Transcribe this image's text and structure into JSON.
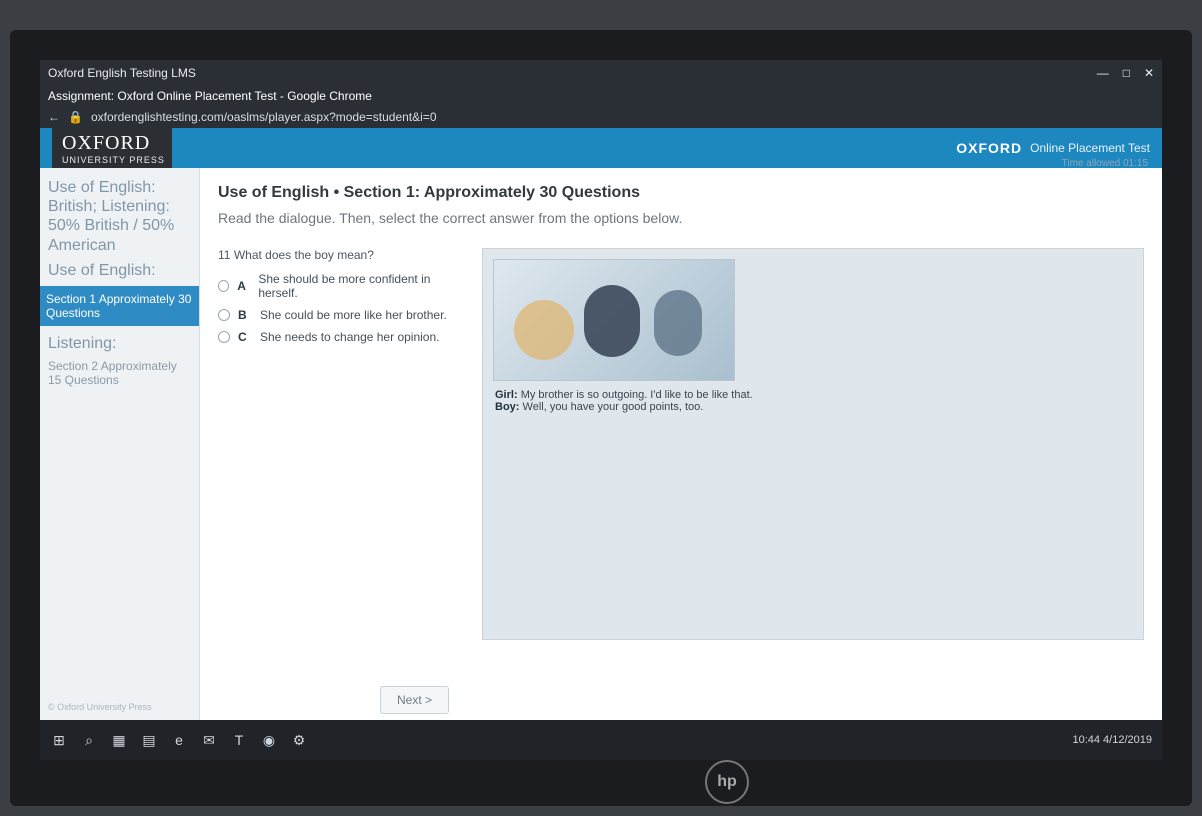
{
  "browser": {
    "tab_title_1": "Oxford English Testing LMS",
    "window_title": "Assignment: Oxford Online Placement Test - Google Chrome",
    "url": "oxfordenglishtesting.com/oaslms/player.aspx?mode=student&i=0",
    "controls": {
      "minimize": "—",
      "maximize": "□",
      "close": "✕"
    }
  },
  "brand": {
    "oxford": "OXFORD",
    "university_press": "UNIVERSITY PRESS",
    "right_title": "OXFORD",
    "right_sub": "Online Placement Test",
    "time_allowed": "Time allowed 01:15"
  },
  "sidebar": {
    "title": "Use of English: British; Listening: 50% British / 50% American",
    "use_of_english": "Use of English:",
    "active": "Section 1 Approximately 30 Questions",
    "listening": "Listening:",
    "listening_item": "Section 2 Approximately 15 Questions",
    "footer": "© Oxford University Press"
  },
  "main": {
    "heading": "Use of English • Section 1: Approximately 30 Questions",
    "instruction": "Read the dialogue. Then, select the correct answer from the options below.",
    "question_number": "11",
    "question_text": "What does the boy mean?",
    "options": [
      {
        "letter": "A",
        "text": "She should be more confident in herself."
      },
      {
        "letter": "B",
        "text": "She could be more like her brother."
      },
      {
        "letter": "C",
        "text": "She needs to change her opinion."
      }
    ],
    "dialogue": {
      "girl_label": "Girl:",
      "girl_text": "My brother is so outgoing. I'd like to be like that.",
      "boy_label": "Boy:",
      "boy_text": "Well, you have your good points, too."
    },
    "next_label": "Next >"
  },
  "taskbar": {
    "icons": [
      "windows-icon",
      "search-icon",
      "task-view-icon",
      "file-explorer-icon",
      "edge-icon",
      "mail-icon",
      "app-icon",
      "chrome-icon",
      "settings-icon"
    ],
    "tray_text": "10:44  4/12/2019"
  },
  "monitor": {
    "brand": "hp"
  }
}
